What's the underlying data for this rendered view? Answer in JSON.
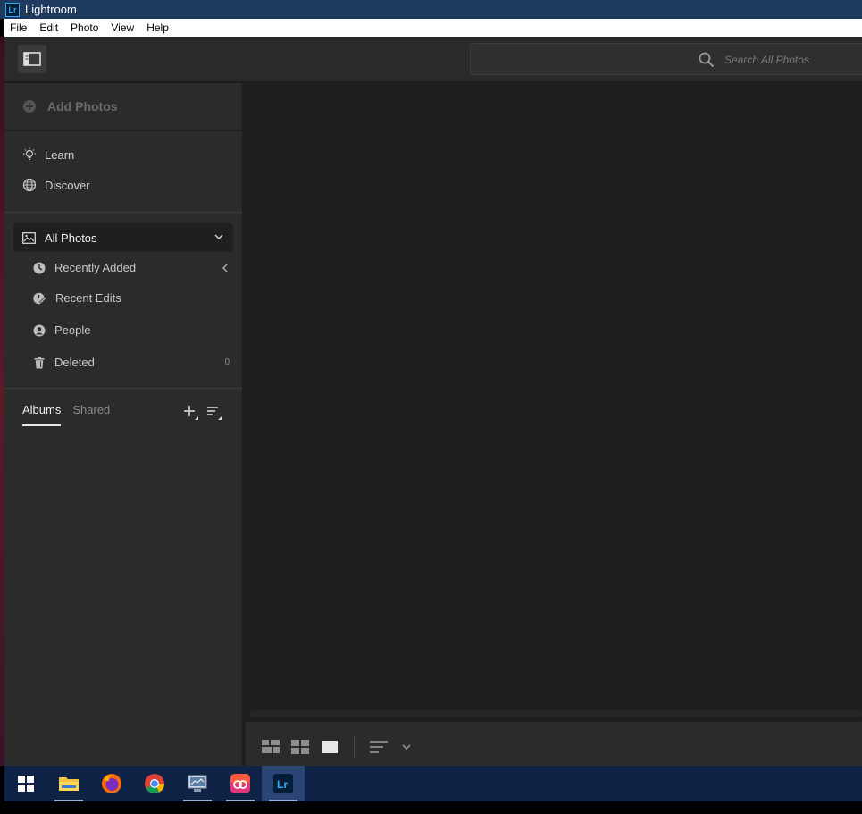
{
  "window": {
    "title": "Lightroom",
    "logo_text": "Lr"
  },
  "menubar": {
    "items": [
      "File",
      "Edit",
      "Photo",
      "View",
      "Help"
    ]
  },
  "topbar": {
    "search_placeholder": "Search All Photos"
  },
  "sidebar": {
    "add_photos_label": "Add Photos",
    "nav": [
      {
        "label": "Learn",
        "icon": "lightbulb-icon"
      },
      {
        "label": "Discover",
        "icon": "globe-icon"
      }
    ],
    "all_photos_label": "All Photos",
    "sub_items": [
      {
        "label": "Recently Added",
        "icon": "clock-icon"
      },
      {
        "label": "Recent Edits",
        "icon": "edit-clock-icon"
      },
      {
        "label": "People",
        "icon": "person-icon"
      },
      {
        "label": "Deleted",
        "icon": "trash-icon",
        "count": "0"
      }
    ],
    "tabs": {
      "albums": "Albums",
      "shared": "Shared"
    }
  },
  "bottombar": {
    "view_modes": [
      "square-grid",
      "photo-grid",
      "detail"
    ],
    "sort_icon": "sort-lines-icon"
  },
  "taskbar": {
    "apps": [
      "windows-start",
      "file-explorer",
      "firefox",
      "chrome",
      "network-monitor",
      "creative-cloud",
      "lightroom"
    ],
    "active": "lightroom"
  },
  "colors": {
    "titlebar": "#1e3a5f",
    "app_bg": "#1e1e1e",
    "sidebar_bg": "#2b2b2b",
    "taskbar": "#0f2347",
    "lr_blue": "#31a8ff"
  }
}
